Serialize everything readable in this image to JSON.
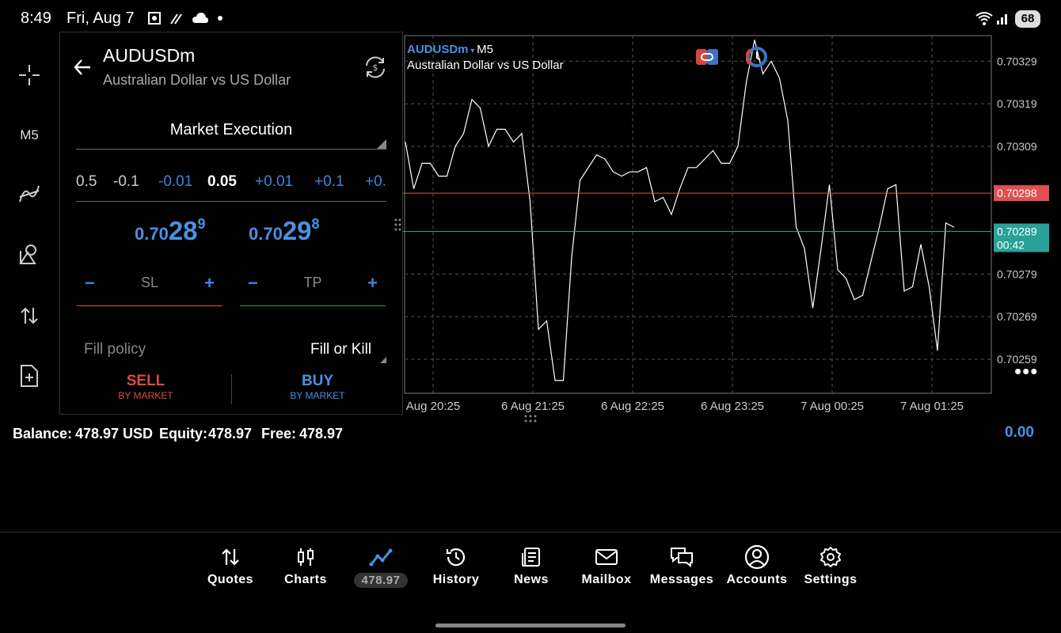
{
  "status_bar": {
    "time": "8:49",
    "date": "Fri, Aug 7",
    "battery": "68"
  },
  "left_toolbar": {
    "timeframe": "M5"
  },
  "order_panel": {
    "symbol": "AUDUSDm",
    "description": "Australian Dollar vs US Dollar",
    "execution": "Market Execution",
    "volume_steps": [
      "0.5",
      "-0.1",
      "-0.01",
      "0.05",
      "+0.01",
      "+0.1",
      "+0."
    ],
    "current_volume": "0.05",
    "bid": {
      "prefix": "0.70",
      "big": "28",
      "sup": "9"
    },
    "ask": {
      "prefix": "0.70",
      "big": "29",
      "sup": "8"
    },
    "sl_label": "SL",
    "tp_label": "TP",
    "minus": "−",
    "plus": "+",
    "fill_policy_label": "Fill policy",
    "fill_policy_value": "Fill or Kill",
    "sell_label": "SELL",
    "sell_sub": "BY MARKET",
    "buy_label": "BUY",
    "buy_sub": "BY MARKET"
  },
  "chart": {
    "symbol": "AUDUSDm",
    "timeframe": "M5",
    "description": "Australian Dollar vs US Dollar",
    "ask_price_label": "0.70298",
    "bid_price_label": "0.70289",
    "countdown": "00:42",
    "more": "•••"
  },
  "chart_data": {
    "type": "line",
    "x_ticks": [
      "Aug 20:25",
      "6 Aug 21:25",
      "6 Aug 22:25",
      "6 Aug 23:25",
      "7 Aug 00:25",
      "7 Aug 01:25"
    ],
    "y_ticks": [
      "0.70329",
      "0.70319",
      "0.70309",
      "0.70279",
      "0.70269",
      "0.70259"
    ],
    "ylim": [
      0.70251,
      0.70335
    ],
    "ask_line": 0.70298,
    "bid_line": 0.70289,
    "grid": true,
    "series": [
      {
        "values": [
          0.7031,
          0.70299,
          0.70305,
          0.70305,
          0.70302,
          0.70302,
          0.70309,
          0.70312,
          0.7032,
          0.70318,
          0.70309,
          0.70313,
          0.70313,
          0.7031,
          0.70312,
          0.70296,
          0.70266,
          0.70268,
          0.70254,
          0.70254,
          0.70283,
          0.70301,
          0.70304,
          0.70307,
          0.70306,
          0.70303,
          0.70302,
          0.70303,
          0.70303,
          0.70304,
          0.70296,
          0.70297,
          0.70293,
          0.70299,
          0.70304,
          0.70304,
          0.70306,
          0.70308,
          0.70305,
          0.70305,
          0.70309,
          0.70324,
          0.70334,
          0.70326,
          0.70329,
          0.70325,
          0.70315,
          0.7029,
          0.70285,
          0.70271,
          0.70285,
          0.703,
          0.7028,
          0.70278,
          0.70273,
          0.70274,
          0.70282,
          0.7029,
          0.70299,
          0.703,
          0.70275,
          0.70276,
          0.70286,
          0.70276,
          0.70261,
          0.70291,
          0.7029
        ]
      }
    ]
  },
  "account": {
    "balance_label": "Balance:",
    "balance_value": "478.97 USD",
    "equity_label": "Equity:",
    "equity_value": "478.97",
    "free_label": "Free:",
    "free_value": "478.97",
    "profit": "0.00"
  },
  "bottom_nav": [
    {
      "label": "Quotes",
      "icon": "arrows-updown-icon"
    },
    {
      "label": "Charts",
      "icon": "candles-icon"
    },
    {
      "label": "478.97",
      "icon": "trade-line-icon"
    },
    {
      "label": "History",
      "icon": "history-icon"
    },
    {
      "label": "News",
      "icon": "news-icon"
    },
    {
      "label": "Mailbox",
      "icon": "mail-icon"
    },
    {
      "label": "Messages",
      "icon": "messages-icon"
    },
    {
      "label": "Accounts",
      "icon": "accounts-icon"
    },
    {
      "label": "Settings",
      "icon": "settings-icon"
    }
  ],
  "colors": {
    "accent": "#4a90e2",
    "sell": "#e04848",
    "ask_line": "#e05050",
    "bid_line": "#2aa198"
  }
}
